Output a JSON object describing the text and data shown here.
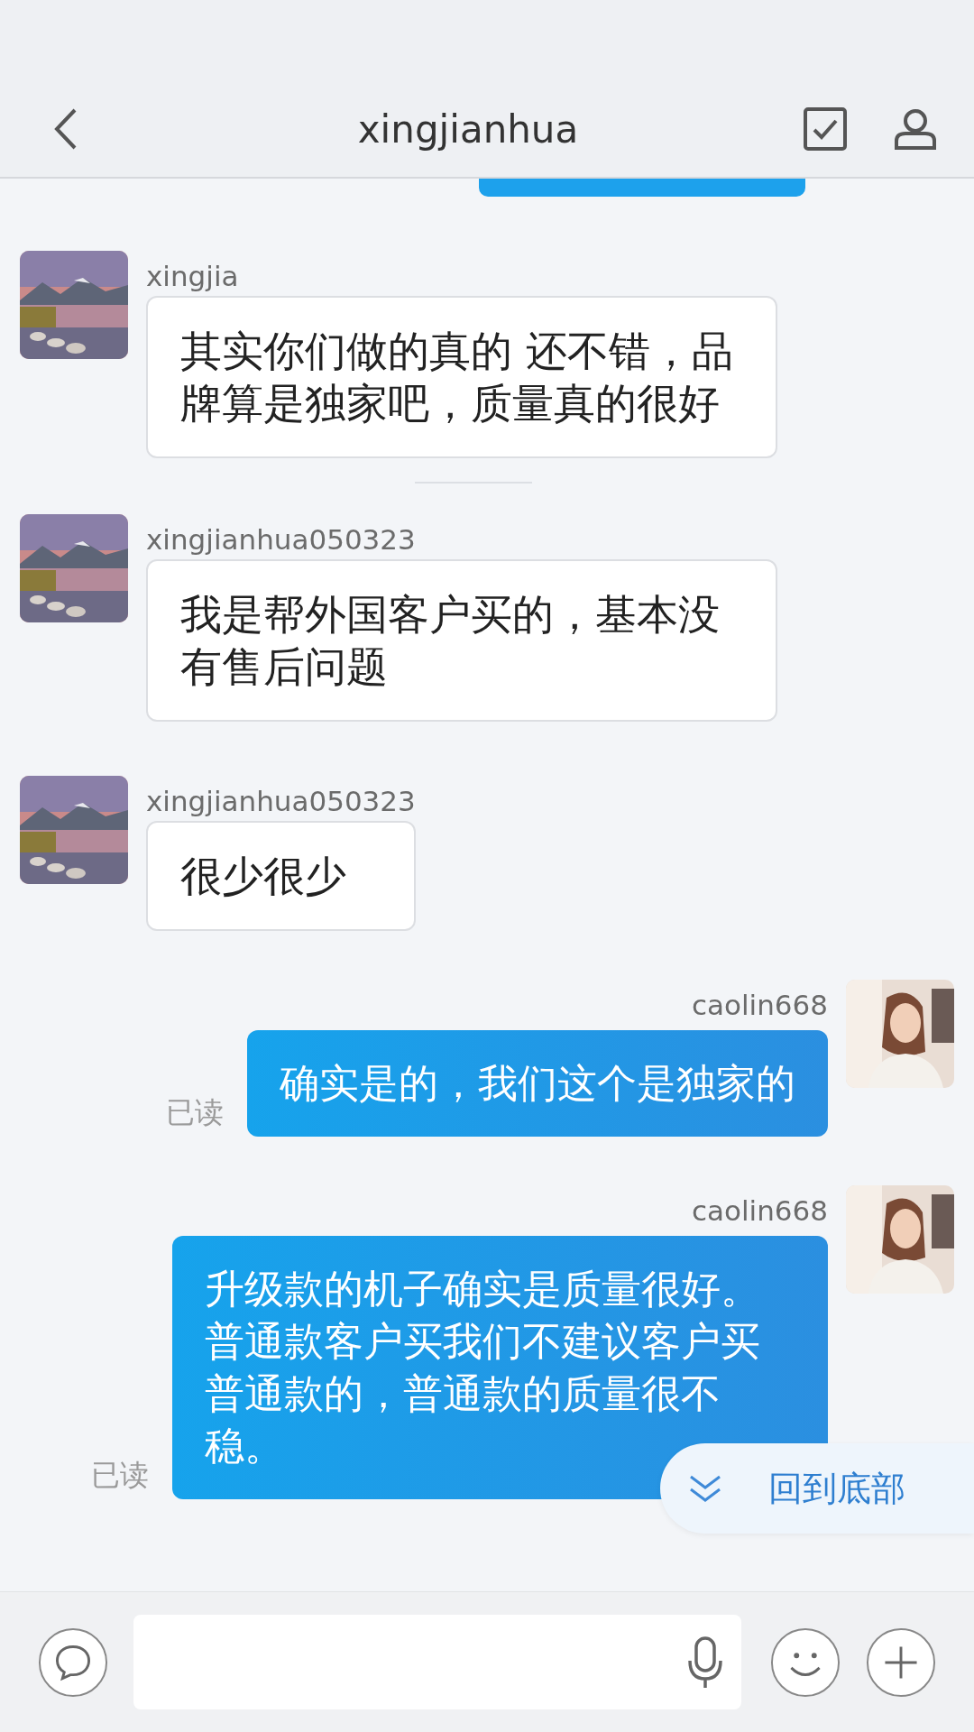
{
  "header": {
    "title": "xingjianhua"
  },
  "messages": [
    {
      "kind": "received",
      "sender": "xingjia",
      "text": "其实你们做的真的 还不错，品牌算是独家吧，质量真的很好"
    },
    {
      "kind": "received",
      "sender": "xingjianhua050323",
      "text": "我是帮外国客户买的，基本没有售后问题"
    },
    {
      "kind": "received",
      "sender": "xingjianhua050323",
      "text": "很少很少"
    },
    {
      "kind": "sent",
      "sender": "caolin668",
      "text": "确实是的，我们这个是独家的",
      "read_receipt": "已读"
    },
    {
      "kind": "sent",
      "sender": "caolin668",
      "text": "升级款的机子确实是质量很好。普通款客户买我们不建议客户买普通款的，普通款的质量很不稳。",
      "read_receipt": "已读"
    }
  ],
  "jump_button": {
    "label": "回到底部"
  }
}
